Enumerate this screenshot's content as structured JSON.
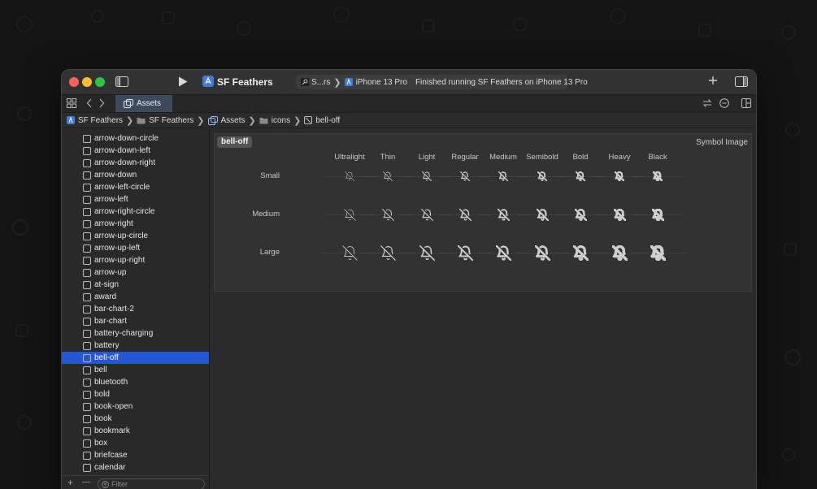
{
  "window": {
    "app_title": "SF Feathers",
    "scheme_short": "S...rs",
    "device": "iPhone 13 Pro",
    "status": "Finished running SF Feathers on iPhone 13 Pro"
  },
  "tabs": [
    {
      "label": "Assets"
    }
  ],
  "breadcrumbs": [
    {
      "label": "SF Feathers",
      "icon": "app-icon"
    },
    {
      "label": "SF Feathers",
      "icon": "folder-icon"
    },
    {
      "label": "Assets",
      "icon": "asset-catalog-icon"
    },
    {
      "label": "icons",
      "icon": "folder-icon"
    },
    {
      "label": "bell-off",
      "icon": "symbol-icon"
    }
  ],
  "sidebar": {
    "items": [
      {
        "label": "arrow-down-circle"
      },
      {
        "label": "arrow-down-left"
      },
      {
        "label": "arrow-down-right"
      },
      {
        "label": "arrow-down"
      },
      {
        "label": "arrow-left-circle"
      },
      {
        "label": "arrow-left"
      },
      {
        "label": "arrow-right-circle"
      },
      {
        "label": "arrow-right"
      },
      {
        "label": "arrow-up-circle"
      },
      {
        "label": "arrow-up-left"
      },
      {
        "label": "arrow-up-right"
      },
      {
        "label": "arrow-up"
      },
      {
        "label": "at-sign"
      },
      {
        "label": "award"
      },
      {
        "label": "bar-chart-2"
      },
      {
        "label": "bar-chart"
      },
      {
        "label": "battery-charging"
      },
      {
        "label": "battery"
      },
      {
        "label": "bell-off"
      },
      {
        "label": "bell"
      },
      {
        "label": "bluetooth"
      },
      {
        "label": "bold"
      },
      {
        "label": "book-open"
      },
      {
        "label": "book"
      },
      {
        "label": "bookmark"
      },
      {
        "label": "box"
      },
      {
        "label": "briefcase"
      },
      {
        "label": "calendar"
      }
    ],
    "selected_index": 18,
    "filter_placeholder": "Filter",
    "add_label": "+",
    "remove_label": "—"
  },
  "editor": {
    "asset_name": "bell-off",
    "asset_kind": "Symbol Image",
    "weights": [
      "Ultralight",
      "Thin",
      "Light",
      "Regular",
      "Medium",
      "Semibold",
      "Bold",
      "Heavy",
      "Black"
    ],
    "scales": [
      "Small",
      "Medium",
      "Large"
    ]
  },
  "colors": {
    "accent": "#2257d6",
    "traffic_red": "#ff5f57",
    "traffic_yellow": "#febc2e",
    "traffic_green": "#28c840"
  }
}
